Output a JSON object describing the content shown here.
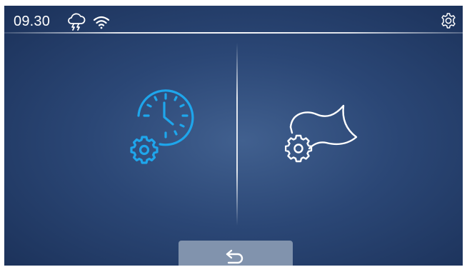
{
  "status_bar": {
    "time": "09.30",
    "weather_icon": "cloud-rain-lightning",
    "wifi_icon": "wifi",
    "settings_icon": "gear"
  },
  "main": {
    "tiles": [
      {
        "icon": "clock-gear",
        "color": "#1ea6ec"
      },
      {
        "icon": "flag-gear",
        "color": "#ffffff"
      }
    ]
  },
  "footer": {
    "back_icon": "return-arrow",
    "button_color": "#8193ad"
  }
}
